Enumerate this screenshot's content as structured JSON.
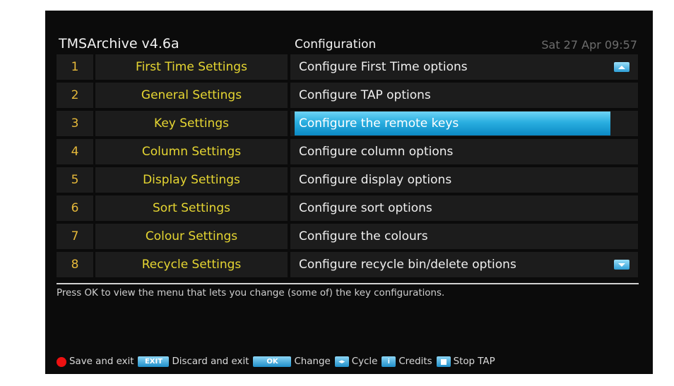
{
  "header": {
    "app_title": "TMSArchive v4.6a",
    "section": "Configuration",
    "datetime": "Sat 27 Apr 09:57"
  },
  "menu": {
    "selected_index": 2,
    "items": [
      {
        "number": "1",
        "name": "First Time Settings",
        "description": "Configure First Time options"
      },
      {
        "number": "2",
        "name": "General Settings",
        "description": "Configure TAP options"
      },
      {
        "number": "3",
        "name": "Key Settings",
        "description": "Configure the remote keys"
      },
      {
        "number": "4",
        "name": "Column Settings",
        "description": "Configure column options"
      },
      {
        "number": "5",
        "name": "Display Settings",
        "description": "Configure display options"
      },
      {
        "number": "6",
        "name": "Sort Settings",
        "description": "Configure sort options"
      },
      {
        "number": "7",
        "name": "Colour Settings",
        "description": "Configure the colours"
      },
      {
        "number": "8",
        "name": "Recycle Settings",
        "description": "Configure recycle bin/delete options"
      }
    ]
  },
  "help_text": "Press OK to view the menu that lets you change (some of) the key configurations.",
  "footer": {
    "save_label": "Save and exit",
    "exit_key": "EXIT",
    "discard_label": "Discard and exit",
    "ok_key": "OK",
    "change_label": "Change",
    "cycle_key": "◂▸",
    "cycle_label": "Cycle",
    "info_key": "i",
    "credits_label": "Credits",
    "stop_label": "Stop TAP"
  },
  "colors": {
    "background": "#0b0b0b",
    "row_bg": "#1c1c1c",
    "number": "#e6b93a",
    "name": "#e6d632",
    "highlight": "#2aaee0",
    "red_key": "#ee1111"
  },
  "icons": {
    "scroll_up": "scroll-up-icon",
    "scroll_down": "scroll-down-icon",
    "red_key": "red-button-icon",
    "stop_key": "stop-square-icon"
  }
}
